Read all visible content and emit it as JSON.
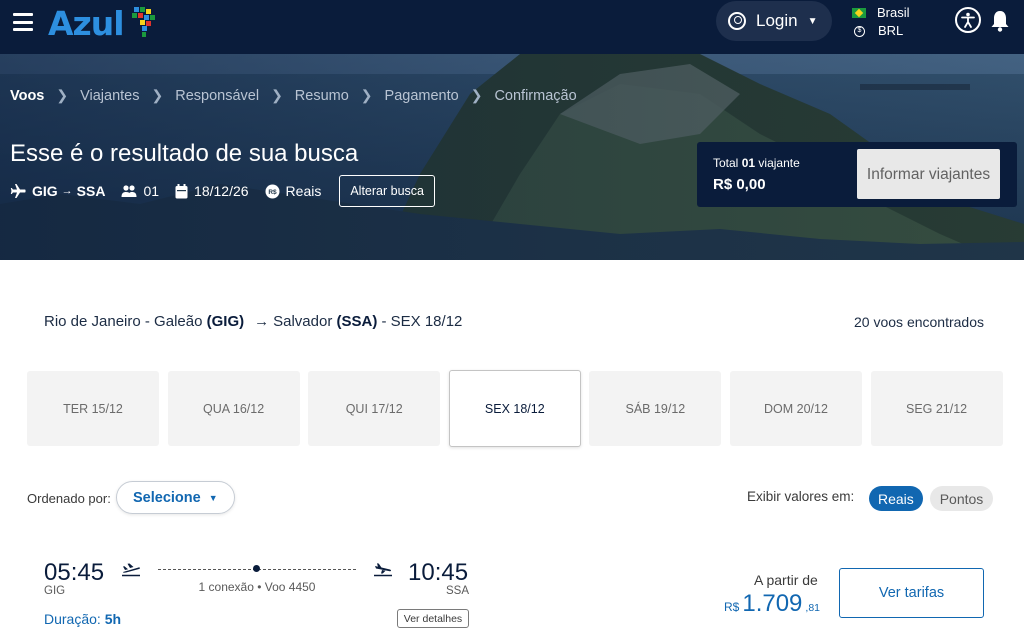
{
  "header": {
    "brand": "Azul",
    "login_label": "Login",
    "country": "Brasil",
    "currency": "BRL"
  },
  "breadcrumb": [
    "Voos",
    "Viajantes",
    "Responsável",
    "Resumo",
    "Pagamento",
    "Confirmação"
  ],
  "search": {
    "title": "Esse é o resultado de sua busca",
    "origin": "GIG",
    "destination": "SSA",
    "passengers": "01",
    "date": "18/12/26",
    "currency_label": "Reais",
    "alter_label": "Alterar busca"
  },
  "total": {
    "label_prefix": "Total",
    "count": "01",
    "label_suffix": "viajante",
    "value": "R$ 0,00",
    "button_label": "Informar viajantes"
  },
  "route": {
    "origin_city": "Rio de Janeiro - Galeão",
    "origin_code": "(GIG)",
    "destination_city": "Salvador",
    "destination_code": "(SSA)",
    "date_label": "- SEX 18/12",
    "results": "20 voos encontrados"
  },
  "date_tabs": [
    {
      "label": "TER 15/12"
    },
    {
      "label": "QUA 16/12"
    },
    {
      "label": "QUI 17/12"
    },
    {
      "label": "SEX 18/12"
    },
    {
      "label": "SÁB 19/12"
    },
    {
      "label": "DOM 20/12"
    },
    {
      "label": "SEG 21/12"
    }
  ],
  "selected_date_index": 3,
  "controls": {
    "sort_label": "Ordenado por:",
    "sort_value": "Selecione",
    "values_label": "Exibir valores em:",
    "reais": "Reais",
    "pontos": "Pontos"
  },
  "flight": {
    "departure_time": "05:45",
    "departure_code": "GIG",
    "arrival_time": "10:45",
    "arrival_code": "SSA",
    "connection": "1 conexão • Voo 4450",
    "duration_label": "Duração:",
    "duration_value": "5h",
    "details_label": "Ver detalhes",
    "from_label": "A partir de",
    "price_currency": "R$",
    "price_integer": "1.709",
    "price_cents": ",81",
    "tariffs_label": "Ver tarifas"
  },
  "colors": {
    "navy": "#0a1c3b",
    "brand_blue": "#2d8fe0",
    "link_blue": "#1167b1"
  }
}
